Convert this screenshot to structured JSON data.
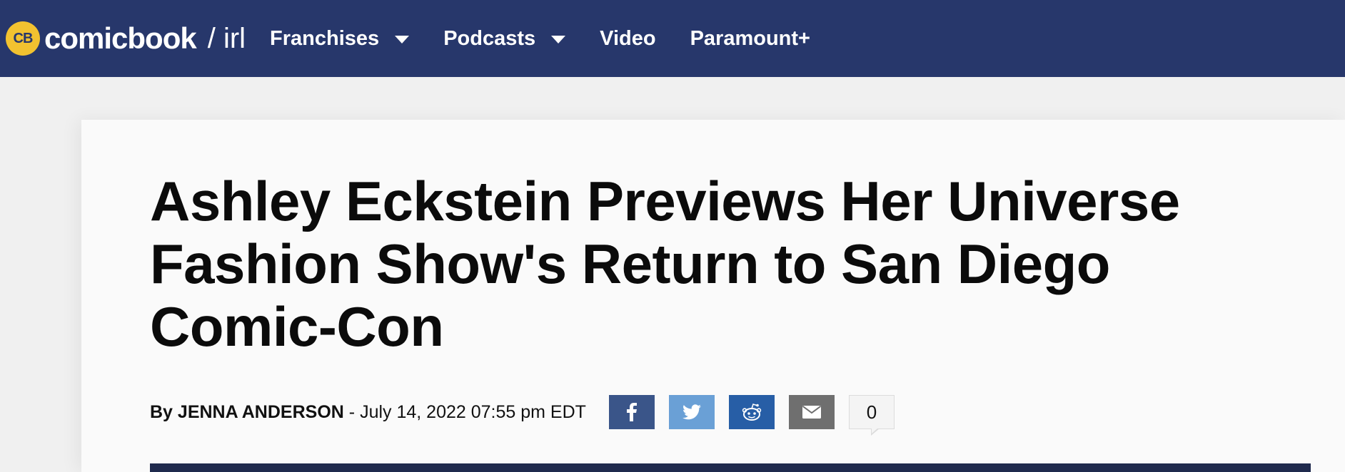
{
  "header": {
    "logo_badge": "CB",
    "logo_word": "comicbook",
    "logo_sub": "/ irl",
    "nav": [
      {
        "label": "Franchises",
        "has_dropdown": true
      },
      {
        "label": "Podcasts",
        "has_dropdown": true
      },
      {
        "label": "Video",
        "has_dropdown": false
      },
      {
        "label": "Paramount+",
        "has_dropdown": false
      }
    ],
    "colors": {
      "background": "#27376b",
      "badge": "#f2c230"
    }
  },
  "article": {
    "headline": "Ashley Eckstein Previews Her Universe Fashion Show's Return to San Diego Comic-Con",
    "byline_prefix": "By",
    "author": "JENNA ANDERSON",
    "date_separator": "-",
    "date": "July 14, 2022 07:55 pm EDT"
  },
  "share": {
    "buttons": [
      {
        "icon": "facebook-icon",
        "color": "#3a5589"
      },
      {
        "icon": "twitter-icon",
        "color": "#6aa0d6"
      },
      {
        "icon": "reddit-icon",
        "color": "#275ea6"
      },
      {
        "icon": "email-icon",
        "color": "#6f6f6f"
      }
    ],
    "comment_count": "0"
  }
}
